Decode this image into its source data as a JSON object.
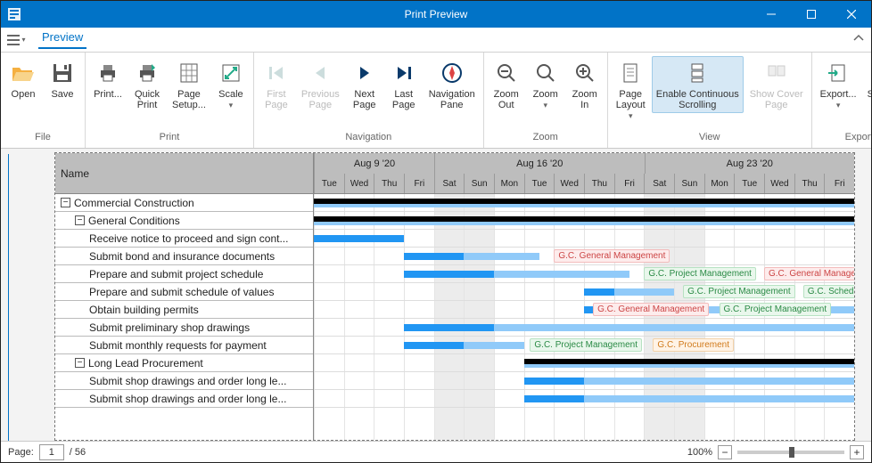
{
  "window": {
    "title": "Print Preview"
  },
  "menu": {
    "preview_tab": "Preview"
  },
  "ribbon": {
    "file": {
      "label": "File",
      "open": "Open",
      "save": "Save"
    },
    "print": {
      "label": "Print",
      "print": "Print...",
      "quick": "Quick\nPrint",
      "setup": "Page\nSetup...",
      "scale": "Scale"
    },
    "nav": {
      "label": "Navigation",
      "first": "First\nPage",
      "prev": "Previous\nPage",
      "next": "Next\nPage",
      "last": "Last\nPage",
      "pane": "Navigation\nPane"
    },
    "zoom": {
      "label": "Zoom",
      "out": "Zoom\nOut",
      "zoom": "Zoom",
      "in": "Zoom\nIn"
    },
    "view": {
      "label": "View",
      "layout": "Page\nLayout",
      "scroll": "Enable Continuous\nScrolling",
      "cover": "Show Cover\nPage"
    },
    "export": {
      "label": "Export",
      "export": "Export...",
      "send": "Send..."
    }
  },
  "gantt": {
    "name_header": "Name",
    "weeks": [
      "Aug 9 '20",
      "Aug 16 '20",
      "Aug 23 '20"
    ],
    "days": [
      "Tue",
      "Wed",
      "Thu",
      "Fri",
      "Sat",
      "Sun",
      "Mon",
      "Tue",
      "Wed",
      "Thu",
      "Fri",
      "Sat",
      "Sun",
      "Mon",
      "Tue",
      "Wed",
      "Thu",
      "Fri"
    ],
    "rows": [
      {
        "name": "Commercial Construction",
        "indent": 0,
        "group": true
      },
      {
        "name": "General Conditions",
        "indent": 1,
        "group": true
      },
      {
        "name": "Receive notice to proceed and sign cont...",
        "indent": 2
      },
      {
        "name": "Submit bond and insurance documents",
        "indent": 2
      },
      {
        "name": "Prepare and submit project schedule",
        "indent": 2
      },
      {
        "name": "Prepare and submit schedule of values",
        "indent": 2
      },
      {
        "name": "Obtain building permits",
        "indent": 2
      },
      {
        "name": "Submit preliminary shop drawings",
        "indent": 2
      },
      {
        "name": "Submit monthly requests for payment",
        "indent": 2
      },
      {
        "name": "Long Lead Procurement",
        "indent": 1,
        "group": true
      },
      {
        "name": "Submit shop drawings and order long le...",
        "indent": 2
      },
      {
        "name": "Submit shop drawings and order long le...",
        "indent": 2
      }
    ],
    "tags": {
      "gcgm": "G.C. General Management",
      "gcpm": "G.C. Project Management",
      "gcsch": "G.C. Scheduler",
      "gcproc": "G.C. Procurement"
    }
  },
  "status": {
    "page_label": "Page:",
    "page_value": "1",
    "page_total": "/ 56",
    "zoom": "100%"
  },
  "colors": {
    "accent": "#0173c7"
  }
}
